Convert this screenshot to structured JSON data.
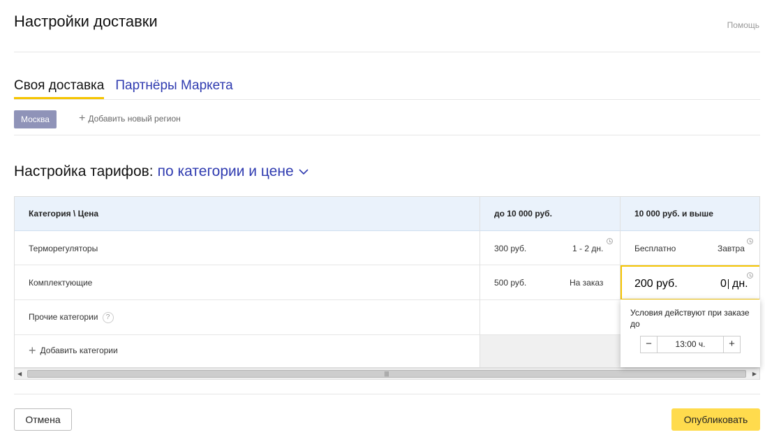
{
  "header": {
    "title": "Настройки доставки",
    "help_label": "Помощь"
  },
  "tabs": [
    {
      "label": "Своя доставка",
      "active": true
    },
    {
      "label": "Партнёры Маркета",
      "active": false
    }
  ],
  "regions": {
    "selected": "Москва",
    "add_label": "Добавить новый регион"
  },
  "tariffs": {
    "title": "Настройка тарифов:",
    "mode": "по категории и цене"
  },
  "table": {
    "headers": [
      "Категория \\ Цена",
      "до 10 000 руб.",
      "10 000 руб. и выше"
    ],
    "rows": [
      {
        "category": "Терморегуляторы",
        "c1_price": "300 руб.",
        "c1_term": "1 - 2 дн.",
        "c2_price": "Бесплатно",
        "c2_term": "Завтра"
      },
      {
        "category": "Комплектующие",
        "c1_price": "500 руб.",
        "c1_term": "На заказ",
        "c2_price": "200 руб.",
        "c2_value": "0",
        "c2_unit": "дн."
      },
      {
        "category": "Прочие категории",
        "help": "?"
      }
    ],
    "add_category_label": "Добавить категории"
  },
  "popup": {
    "text": "Условия действуют при заказе до",
    "time_value": "13:00 ч.",
    "minus": "−",
    "plus": "+"
  },
  "footer": {
    "cancel_label": "Отмена",
    "publish_label": "Опубликовать"
  },
  "colors": {
    "accent": "#f5c400",
    "link": "#2f3bb0",
    "publish_bg": "#ffdb4d",
    "region_pill": "#8f93b8"
  }
}
